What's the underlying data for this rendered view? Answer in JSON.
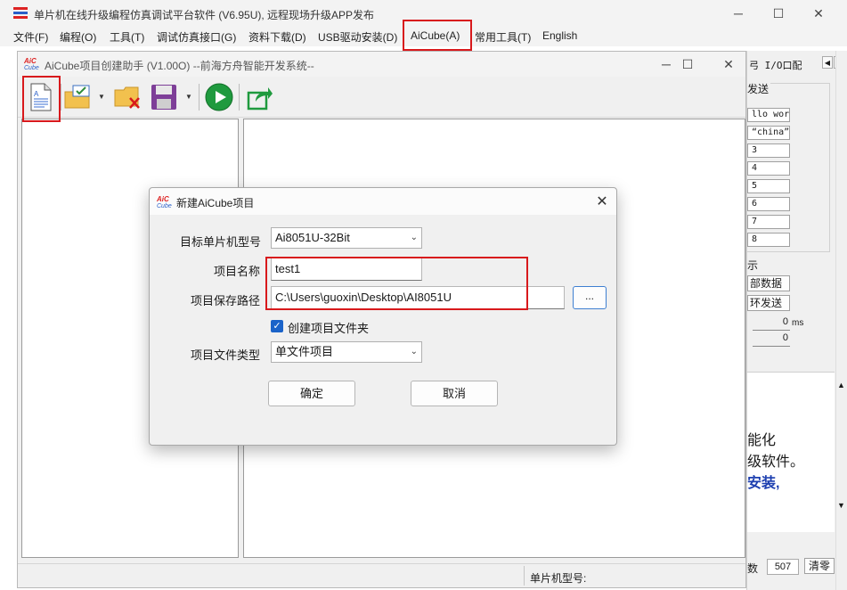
{
  "main_window": {
    "title": "单片机在线升级编程仿真调试平台软件 (V6.95U), 远程现场升级APP发布",
    "menu": [
      "文件(F)",
      "编程(O)",
      "工具(T)",
      "调试仿真接口(G)",
      "资料下载(D)",
      "USB驱动安装(D)",
      "AiCube(A)",
      "常用工具(T)",
      "English"
    ],
    "controls": {
      "minimize": "─",
      "maximize": "☐",
      "close": "✕"
    },
    "side_panel": {
      "tab_text": "弓  I/O口配",
      "send_group_title": "发送",
      "send_rows": [
        "llo worl",
        "“china”",
        "3",
        "4",
        "5",
        "6",
        "7",
        "8"
      ],
      "show_label": "示",
      "btn_data": "部数据",
      "btn_loop": "环发送",
      "interval_value": "0",
      "interval_unit": "ms",
      "count_value": "0",
      "text_lines": [
        "能化",
        "级软件。",
        "安装,"
      ],
      "byte_label": "数",
      "byte_value": "507",
      "clear_label": "清零"
    }
  },
  "helper_window": {
    "title": "AiCube项目创建助手 (V1.00O) --前海方舟智能开发系统--",
    "controls": {
      "minimize": "─",
      "maximize": "☐",
      "close": "✕"
    },
    "toolbar": {
      "new_project": "new-document-icon",
      "open": "folder-check-icon",
      "delete": "folder-delete-icon",
      "save": "save-disk-icon",
      "run": "green-play-icon",
      "export": "export-arrow-icon"
    },
    "status": {
      "mcu_label": "单片机型号:"
    }
  },
  "dialog": {
    "title": "新建AiCube项目",
    "close": "✕",
    "fields": {
      "mcu_label": "目标单片机型号",
      "mcu_value": "Ai8051U-32Bit",
      "name_label": "项目名称",
      "name_value": "test1",
      "path_label": "项目保存路径",
      "path_value": "C:\\Users\\guoxin\\Desktop\\AI8051U",
      "browse_label": "...",
      "create_folder_label": "创建项目文件夹",
      "create_folder_checked": true,
      "type_label": "项目文件类型",
      "type_value": "单文件项目"
    },
    "ok_label": "确定",
    "cancel_label": "取消"
  },
  "colors": {
    "highlight": "#d8191c",
    "checkbox": "#1b63c9",
    "accent": "#3e7fd1"
  }
}
